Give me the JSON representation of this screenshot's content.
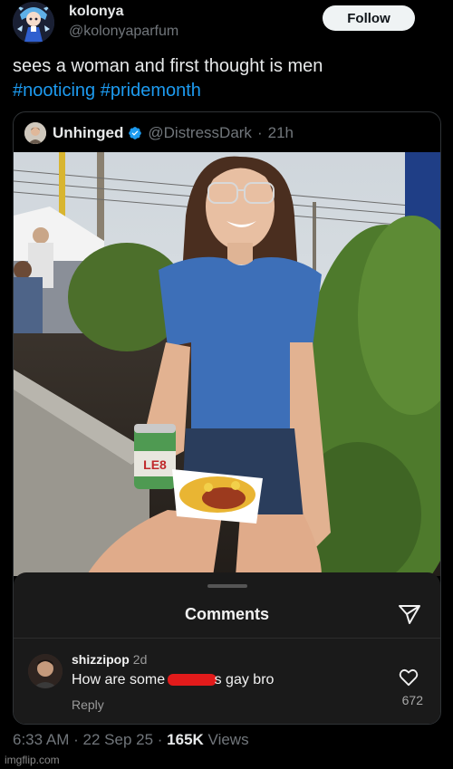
{
  "author": {
    "display_name": "kolonya",
    "handle": "@kolonyaparfum",
    "avatar_icon": "anime-girl-avatar"
  },
  "follow_label": "Follow",
  "tweet": {
    "text": "sees a woman and first thought is men",
    "hashtags": [
      "#nooticing",
      "#pridemonth"
    ]
  },
  "quote": {
    "name": "Unhinged",
    "handle": "@DistressDark",
    "separator": "·",
    "age": "21h",
    "verified_icon": "verified-badge-icon",
    "photo_icon": "outdoor-photo"
  },
  "comments": {
    "title": "Comments",
    "items": [
      {
        "user": "shizzipop",
        "time": "2d",
        "text_before": "How are some",
        "text_after": "s gay bro",
        "reply_label": "Reply",
        "likes": "672"
      }
    ]
  },
  "meta": {
    "time": "6:33 AM",
    "sep1": "·",
    "date": "22 Sep 25",
    "sep2": "·",
    "views_count": "165K",
    "views_label": "Views"
  },
  "watermark": "imgflip.com",
  "colors": {
    "background": "#000000",
    "text": "#e7e9ea",
    "muted": "#71767b",
    "link": "#1d9bf0",
    "verified": "#1d9bf0",
    "sheet": "#1a1a1a",
    "redaction": "#e21b1b"
  }
}
